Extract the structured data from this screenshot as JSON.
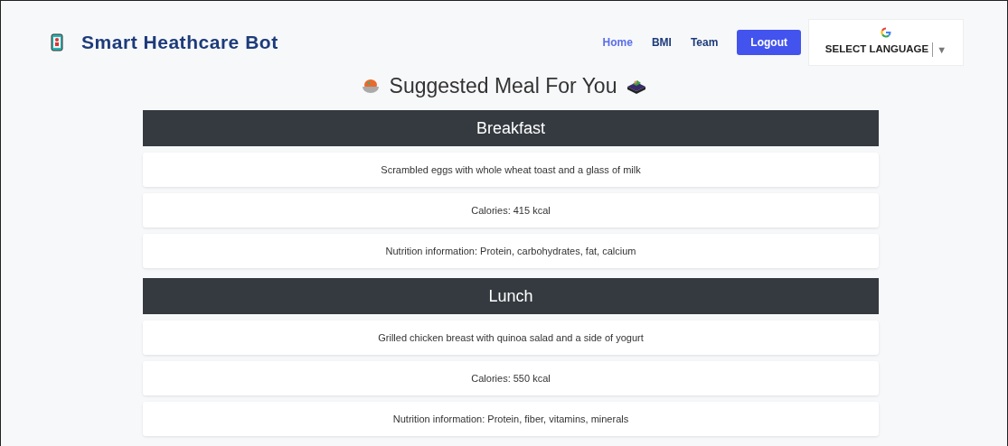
{
  "brand": {
    "title": "Smart Heathcare Bot"
  },
  "nav": [
    {
      "label": "Home",
      "selected": true
    },
    {
      "label": "BMI",
      "selected": false
    },
    {
      "label": "Team",
      "selected": false
    }
  ],
  "logout_button": "Logout",
  "language_select": {
    "label": "SELECT LANGUAGE",
    "arrow": "▼"
  },
  "heading": "Suggested Meal For You",
  "meals": [
    {
      "name": "Breakfast",
      "details": [
        "Scrambled eggs with whole wheat toast and a glass of milk",
        "Calories: 415 kcal",
        "Nutrition information: Protein, carbohydrates, fat, calcium"
      ]
    },
    {
      "name": "Lunch",
      "details": [
        "Grilled chicken breast with quinoa salad and a side of yogurt",
        "Calories: 550 kcal",
        "Nutrition information: Protein, fiber, vitamins, minerals"
      ]
    }
  ]
}
